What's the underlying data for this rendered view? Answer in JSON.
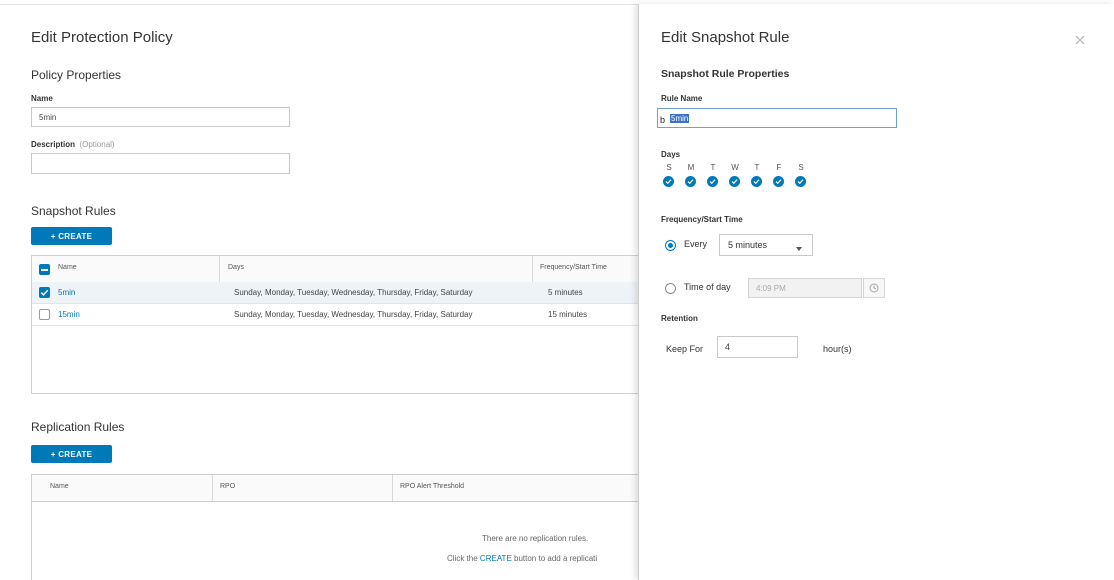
{
  "policy": {
    "title": "Edit Protection Policy",
    "properties_heading": "Policy Properties",
    "name_label": "Name",
    "name_value": "5min",
    "description_label": "Description",
    "description_optional": "(Optional)",
    "description_value": ""
  },
  "snapshot_rules": {
    "heading": "Snapshot Rules",
    "create_label": "+ CREATE",
    "columns": [
      "Name",
      "Days",
      "Frequency/Start Time"
    ],
    "rows": [
      {
        "name": "5min",
        "days": "Sunday, Monday, Tuesday, Wednesday, Thursday, Friday, Saturday",
        "frequency": "5 minutes",
        "checked": true
      },
      {
        "name": "15min",
        "days": "Sunday, Monday, Tuesday, Wednesday, Thursday, Friday, Saturday",
        "frequency": "15 minutes",
        "checked": false
      }
    ]
  },
  "replication_rules": {
    "heading": "Replication Rules",
    "create_label": "+ CREATE",
    "columns": [
      "Name",
      "RPO",
      "RPO Alert Threshold"
    ],
    "empty_text": "There are no replication rules.",
    "hint_prefix": "Click the",
    "hint_link": "CREATE",
    "hint_suffix": "button to add a replicati"
  },
  "snapshot_rule_panel": {
    "title": "Edit Snapshot Rule",
    "close_icon": "close-icon",
    "properties_heading": "Snapshot Rule Properties",
    "rule_name_label": "Rule Name",
    "rule_name_value": "5min",
    "days_label": "Days",
    "days": [
      "S",
      "M",
      "T",
      "W",
      "T",
      "F",
      "S"
    ],
    "frequency_label": "Frequency/Start Time",
    "every_label": "Every",
    "every_value": "5 minutes",
    "time_of_day_label": "Time of day",
    "time_of_day_value": "4:09 PM",
    "clock_icon": "clock-icon",
    "retention_label": "Retention",
    "keep_for_label": "Keep For",
    "keep_for_value": "4",
    "unit_label": "hour(s)"
  },
  "colors": {
    "accent": "#0079b8"
  }
}
